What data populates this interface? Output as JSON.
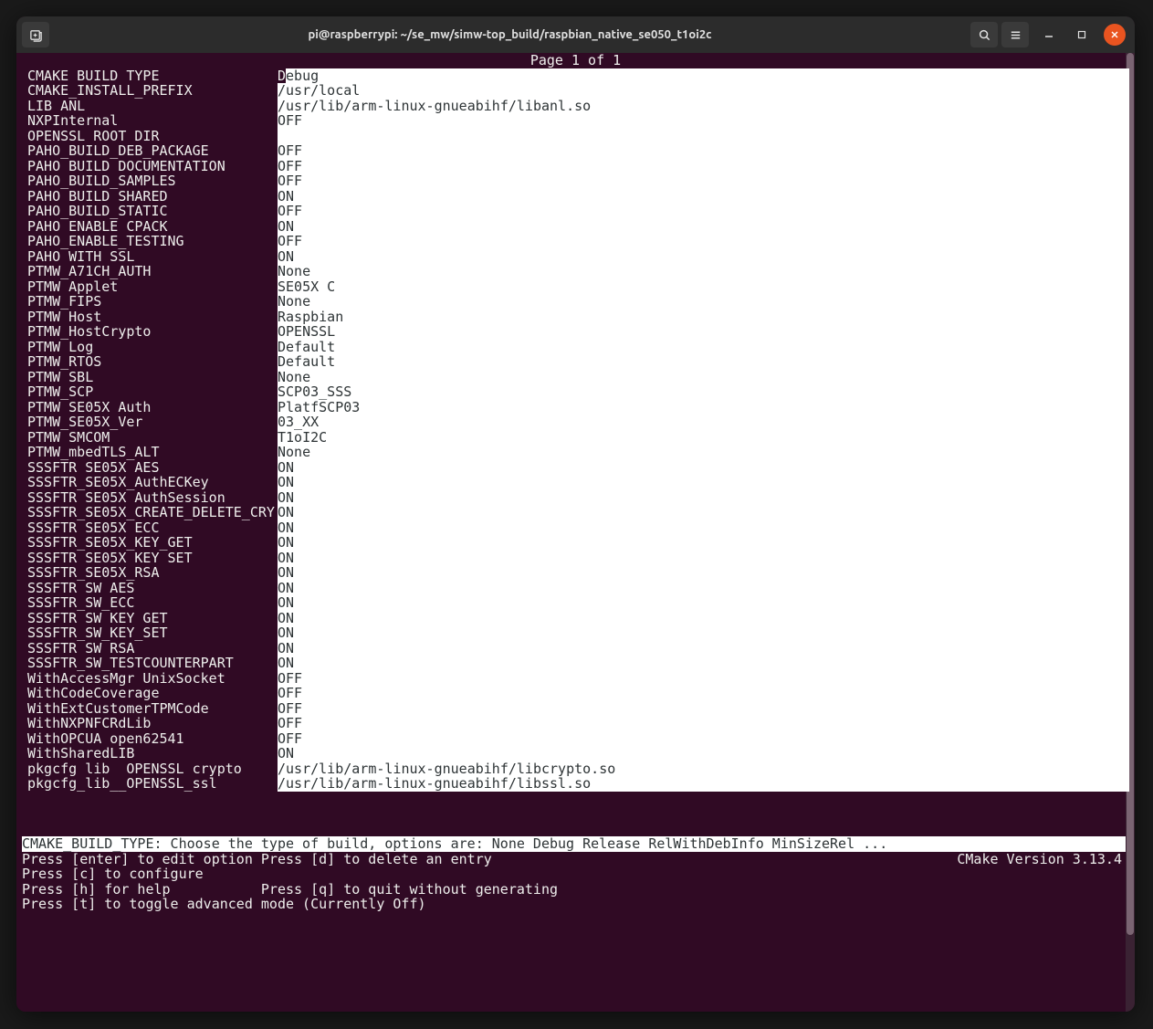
{
  "window": {
    "title": "pi@raspberrypi: ~/se_mw/simw-top_build/raspbian_native_se050_t1oi2c"
  },
  "page_indicator": "Page 1 of 1",
  "rows": [
    {
      "key": "CMAKE_BUILD_TYPE",
      "value": "Debug",
      "selected": true
    },
    {
      "key": "CMAKE_INSTALL_PREFIX",
      "value": "/usr/local"
    },
    {
      "key": "LIB_ANL",
      "value": "/usr/lib/arm-linux-gnueabihf/libanl.so"
    },
    {
      "key": "NXPInternal",
      "value": "OFF"
    },
    {
      "key": "OPENSSL_ROOT_DIR",
      "value": ""
    },
    {
      "key": "PAHO_BUILD_DEB_PACKAGE",
      "value": "OFF"
    },
    {
      "key": "PAHO_BUILD_DOCUMENTATION",
      "value": "OFF"
    },
    {
      "key": "PAHO_BUILD_SAMPLES",
      "value": "OFF"
    },
    {
      "key": "PAHO_BUILD_SHARED",
      "value": "ON"
    },
    {
      "key": "PAHO_BUILD_STATIC",
      "value": "OFF"
    },
    {
      "key": "PAHO_ENABLE_CPACK",
      "value": "ON"
    },
    {
      "key": "PAHO_ENABLE_TESTING",
      "value": "OFF"
    },
    {
      "key": "PAHO_WITH_SSL",
      "value": "ON"
    },
    {
      "key": "PTMW_A71CH_AUTH",
      "value": "None"
    },
    {
      "key": "PTMW_Applet",
      "value": "SE05X_C"
    },
    {
      "key": "PTMW_FIPS",
      "value": "None"
    },
    {
      "key": "PTMW_Host",
      "value": "Raspbian"
    },
    {
      "key": "PTMW_HostCrypto",
      "value": "OPENSSL"
    },
    {
      "key": "PTMW_Log",
      "value": "Default"
    },
    {
      "key": "PTMW_RTOS",
      "value": "Default"
    },
    {
      "key": "PTMW_SBL",
      "value": "None"
    },
    {
      "key": "PTMW_SCP",
      "value": "SCP03_SSS"
    },
    {
      "key": "PTMW_SE05X_Auth",
      "value": "PlatfSCP03"
    },
    {
      "key": "PTMW_SE05X_Ver",
      "value": "03_XX"
    },
    {
      "key": "PTMW_SMCOM",
      "value": "T1oI2C"
    },
    {
      "key": "PTMW_mbedTLS_ALT",
      "value": "None"
    },
    {
      "key": "SSSFTR_SE05X_AES",
      "value": "ON"
    },
    {
      "key": "SSSFTR_SE05X_AuthECKey",
      "value": "ON"
    },
    {
      "key": "SSSFTR_SE05X_AuthSession",
      "value": "ON"
    },
    {
      "key": "SSSFTR_SE05X_CREATE_DELETE_CRY",
      "value": "ON"
    },
    {
      "key": "SSSFTR_SE05X_ECC",
      "value": "ON"
    },
    {
      "key": "SSSFTR_SE05X_KEY_GET",
      "value": "ON"
    },
    {
      "key": "SSSFTR_SE05X_KEY_SET",
      "value": "ON"
    },
    {
      "key": "SSSFTR_SE05X_RSA",
      "value": "ON"
    },
    {
      "key": "SSSFTR_SW_AES",
      "value": "ON"
    },
    {
      "key": "SSSFTR_SW_ECC",
      "value": "ON"
    },
    {
      "key": "SSSFTR_SW_KEY_GET",
      "value": "ON"
    },
    {
      "key": "SSSFTR_SW_KEY_SET",
      "value": "ON"
    },
    {
      "key": "SSSFTR_SW_RSA",
      "value": "ON"
    },
    {
      "key": "SSSFTR_SW_TESTCOUNTERPART",
      "value": "ON"
    },
    {
      "key": "WithAccessMgr_UnixSocket",
      "value": "OFF"
    },
    {
      "key": "WithCodeCoverage",
      "value": "OFF"
    },
    {
      "key": "WithExtCustomerTPMCode",
      "value": "OFF"
    },
    {
      "key": "WithNXPNFCRdLib",
      "value": "OFF"
    },
    {
      "key": "WithOPCUA_open62541",
      "value": "OFF"
    },
    {
      "key": "WithSharedLIB",
      "value": "ON"
    },
    {
      "key": "pkgcfg_lib__OPENSSL_crypto",
      "value": "/usr/lib/arm-linux-gnueabihf/libcrypto.so"
    },
    {
      "key": "pkgcfg_lib__OPENSSL_ssl",
      "value": "/usr/lib/arm-linux-gnueabihf/libssl.so"
    }
  ],
  "status": {
    "desc": "CMAKE_BUILD_TYPE: Choose the type of build, options are: None Debug Release RelWithDebInfo MinSizeRel ...",
    "version": "CMake Version 3.13.4",
    "help": [
      {
        "left": "Press [enter] to edit option Press [d] to delete an entry",
        "right": "CMake Version 3.13.4"
      },
      {
        "left": "Press [c] to configure"
      },
      {
        "left": "Press [h] for help           Press [q] to quit without generating"
      },
      {
        "left": "Press [t] to toggle advanced mode (Currently Off)"
      }
    ]
  }
}
